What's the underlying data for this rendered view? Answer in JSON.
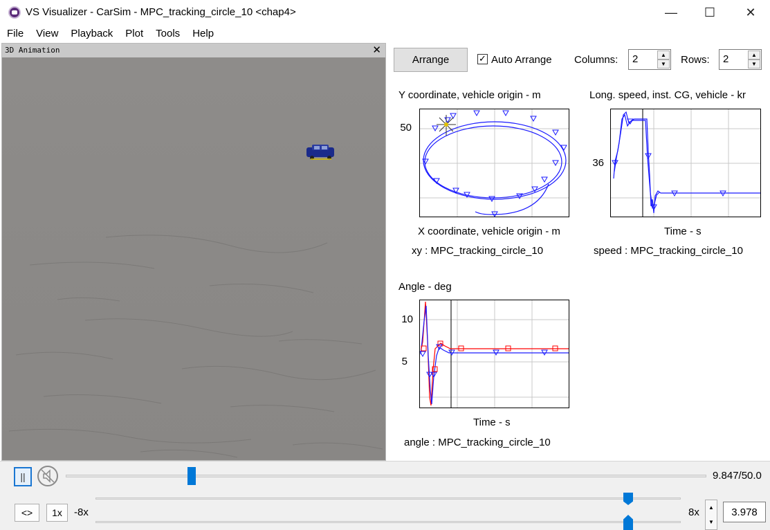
{
  "window": {
    "title": "VS Visualizer - CarSim - MPC_tracking_circle_10 <chap4>",
    "minimize_glyph": "—",
    "maximize_glyph": "☐",
    "close_glyph": "✕"
  },
  "menu": [
    "File",
    "View",
    "Playback",
    "Plot",
    "Tools",
    "Help"
  ],
  "animation_panel": {
    "title": "3D Animation",
    "close_glyph": "✕"
  },
  "toolbar": {
    "arrange_label": "Arrange",
    "auto_arrange_label": "Auto Arrange",
    "auto_arrange_checked": true,
    "columns_label": "Columns:",
    "columns_value": "2",
    "rows_label": "Rows:",
    "rows_value": "2"
  },
  "plots": {
    "xy": {
      "title": "Y coordinate, vehicle origin - m",
      "ytick": "50",
      "xlabel": "X coordinate, vehicle origin - m",
      "caption": "xy : MPC_tracking_circle_10"
    },
    "speed": {
      "title": "Long. speed, inst. CG, vehicle - kr",
      "ytick": "36",
      "xlabel": "Time - s",
      "caption": "speed : MPC_tracking_circle_10"
    },
    "angle": {
      "title": "Angle - deg",
      "ytick_top": "10",
      "ytick_mid": "5",
      "xlabel": "Time - s",
      "caption": "angle : MPC_tracking_circle_10"
    }
  },
  "playback": {
    "pause_glyph": "||",
    "time_readout": "9.847/50.0",
    "progress": 0.197,
    "reverse_label": "<>",
    "one_x_label": "1x",
    "speed_min_label": "-8x",
    "speed_max_label": "8x",
    "speed_value": "3.978"
  },
  "colors": {
    "accent": "#0078d7",
    "series_blue": "#1a1aff",
    "series_red": "#ff0000",
    "ground": "#8b8987"
  }
}
